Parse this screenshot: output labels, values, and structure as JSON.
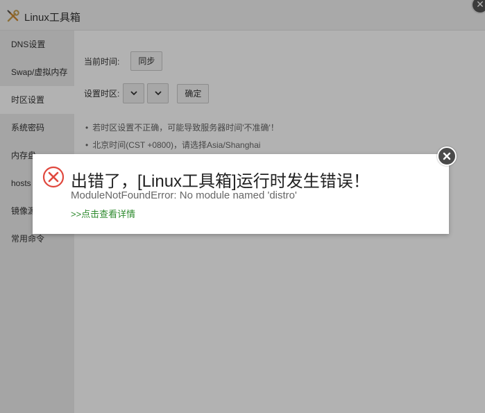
{
  "app": {
    "title": "Linux工具箱",
    "close_glyph": "✕"
  },
  "sidebar": {
    "items": [
      {
        "label": "DNS设置"
      },
      {
        "label": "Swap/虚拟内存"
      },
      {
        "label": "时区设置",
        "active": true
      },
      {
        "label": "系统密码"
      },
      {
        "label": "内存盘"
      },
      {
        "label": "hosts"
      },
      {
        "label": "镜像源"
      },
      {
        "label": "常用命令"
      }
    ]
  },
  "timezone": {
    "current_time_label": "当前时间:",
    "sync_button": "同步",
    "set_timezone_label": "设置时区:",
    "confirm_button": "确定",
    "notes": [
      "若时区设置不正确，可能导致服务器时间'不准确'！",
      "北京时间(CST +0800)，请选择Asia/Shanghai"
    ]
  },
  "dialog": {
    "title": "出错了，[Linux工具箱]运行时发生错误！",
    "message": "ModuleNotFoundError: No module named 'distro'",
    "details_link": ">>点击查看详情"
  },
  "colors": {
    "error_red": "#e0483e",
    "link_green": "#2e8b2e",
    "overlay": "rgba(0,0,0,0.30)"
  }
}
